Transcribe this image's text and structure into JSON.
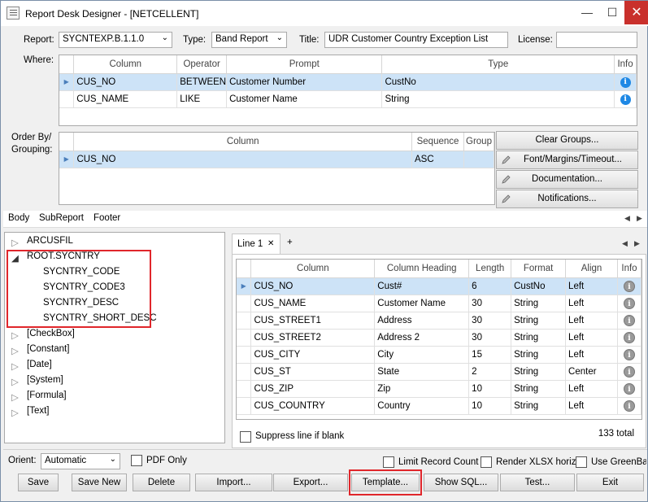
{
  "window": {
    "title": "Report Desk Designer - [NETCELLENT]"
  },
  "header": {
    "report_label": "Report:",
    "report_value": "SYCNTEXP.B.1.1.0",
    "type_label": "Type:",
    "type_value": "Band Report",
    "title_label": "Title:",
    "title_value": "UDR Customer Country Exception List",
    "license_label": "License:",
    "license_value": ""
  },
  "where": {
    "label": "Where:",
    "columns": [
      "Column",
      "Operator",
      "Prompt",
      "Type",
      "Info"
    ],
    "rows": [
      {
        "column": "CUS_NO",
        "operator": "BETWEEN",
        "prompt": "Customer Number",
        "type": "CustNo"
      },
      {
        "column": "CUS_NAME",
        "operator": "LIKE",
        "prompt": "Customer Name",
        "type": "String"
      }
    ]
  },
  "order": {
    "label1": "Order By/",
    "label2": "Grouping:",
    "columns": [
      "Column",
      "Sequence",
      "Group"
    ],
    "rows": [
      {
        "column": "CUS_NO",
        "sequence": "ASC",
        "group": ""
      }
    ]
  },
  "side_buttons": {
    "clear_groups": "Clear Groups...",
    "font_margins": "Font/Margins/Timeout...",
    "documentation": "Documentation...",
    "notifications": "Notifications..."
  },
  "section_tabs": [
    "Body",
    "SubReport",
    "Footer"
  ],
  "tree": {
    "items": [
      "ARCUSFIL",
      "ROOT.SYCNTRY",
      "SYCNTRY_CODE",
      "SYCNTRY_CODE3",
      "SYCNTRY_DESC",
      "SYCNTRY_SHORT_DESC",
      "[CheckBox]",
      "[Constant]",
      "[Date]",
      "[System]",
      "[Formula]",
      "[Text]"
    ]
  },
  "line_tabs": {
    "active": "Line 1",
    "close": "✕",
    "add": "+"
  },
  "line_grid": {
    "columns": [
      "Column",
      "Column Heading",
      "Length",
      "Format",
      "Align",
      "Info"
    ],
    "rows": [
      {
        "column": "CUS_NO",
        "heading": "Cust#",
        "length": "6",
        "format": "CustNo",
        "align": "Left"
      },
      {
        "column": "CUS_NAME",
        "heading": "Customer Name",
        "length": "30",
        "format": "String",
        "align": "Left"
      },
      {
        "column": "CUS_STREET1",
        "heading": "Address",
        "length": "30",
        "format": "String",
        "align": "Left"
      },
      {
        "column": "CUS_STREET2",
        "heading": "Address 2",
        "length": "30",
        "format": "String",
        "align": "Left"
      },
      {
        "column": "CUS_CITY",
        "heading": "City",
        "length": "15",
        "format": "String",
        "align": "Left"
      },
      {
        "column": "CUS_ST",
        "heading": "State",
        "length": "2",
        "format": "String",
        "align": "Center"
      },
      {
        "column": "CUS_ZIP",
        "heading": "Zip",
        "length": "10",
        "format": "String",
        "align": "Left"
      },
      {
        "column": "CUS_COUNTRY",
        "heading": "Country",
        "length": "10",
        "format": "String",
        "align": "Left"
      }
    ],
    "total": "133 total"
  },
  "suppress_label": "Suppress line if blank",
  "options": {
    "orient_label": "Orient:",
    "orient_value": "Automatic",
    "pdf_only": "PDF Only",
    "limit_record": "Limit Record Count",
    "render_xlsx": "Render XLSX horiz.",
    "use_greenbar": "Use GreenBar"
  },
  "buttons": {
    "save": "Save",
    "save_new": "Save New",
    "delete": "Delete",
    "import": "Import...",
    "export": "Export...",
    "template": "Template...",
    "show_sql": "Show SQL...",
    "test": "Test...",
    "exit": "Exit"
  },
  "colors": {
    "highlight": "#e0262b",
    "selection": "#cde3f7"
  }
}
